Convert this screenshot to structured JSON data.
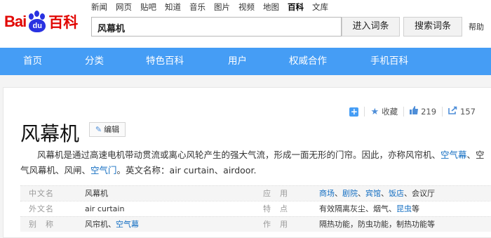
{
  "logo": {
    "bai": "Bai",
    "du": "du",
    "baike": "百科"
  },
  "topnav": [
    "新闻",
    "网页",
    "贴吧",
    "知道",
    "音乐",
    "图片",
    "视频",
    "地图",
    "百科",
    "文库"
  ],
  "search": {
    "value": "风幕机",
    "enter_label": "进入词条",
    "search_label": "搜索词条",
    "help_label": "帮助"
  },
  "menu": [
    "首页",
    "分类",
    "特色百科",
    "用户",
    "权威合作",
    "手机百科"
  ],
  "actions": {
    "favorite_label": "收藏",
    "like_count": "219",
    "share_count": "157"
  },
  "entry": {
    "title": "风幕机",
    "edit_label": "编辑",
    "summary_p1": "风幕机是通过高速电机带动贯流或离心风轮产生的强大气流，形成一面无形的门帘。因此，亦称风帘机、",
    "link_a": "空气幕",
    "summary_p2": "、空气风幕机、风闸、",
    "link_b": "空气门",
    "summary_p3": "。英文名称：air curtain、airdoor."
  },
  "basic_info": [
    {
      "name": "中文名",
      "value": "风幕机",
      "name2": "应　用",
      "value2_links": [
        "商场",
        "剧院",
        "宾馆",
        "饭店"
      ],
      "value2_tail": "会议厅"
    },
    {
      "name": "外文名",
      "value": "air curtain",
      "name2": "特　点",
      "value2_pre": "有效隔离灰尘、烟气、",
      "value2_link": "昆虫",
      "value2_post": "等"
    },
    {
      "name": "别　称",
      "value_pre": "风帘机、",
      "value_link": "空气幕",
      "name2": "作　用",
      "value2": "隔热功能，防虫功能，制热功能等"
    }
  ]
}
